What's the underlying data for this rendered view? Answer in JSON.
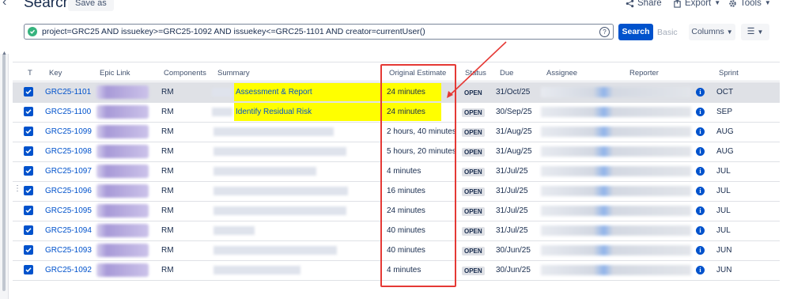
{
  "header": {
    "title": "Search",
    "save_as": "Save as",
    "share": "Share",
    "export": "Export",
    "tools": "Tools"
  },
  "search": {
    "jql": "project=GRC25 AND issuekey>=GRC25-1092 AND issuekey<=GRC25-1101 AND creator=currentUser()",
    "search_button": "Search",
    "basic_link": "Basic",
    "columns_button": "Columns"
  },
  "columns": [
    "T",
    "Key",
    "Epic Link",
    "Components",
    "Summary",
    "Original Estimate",
    "Status",
    "Due",
    "Assignee",
    "Reporter",
    "Sprint"
  ],
  "rows": [
    {
      "key": "GRC25-1101",
      "component": "RM",
      "summary": "Assessment & Report",
      "estimate": "24 minutes",
      "status": "OPEN",
      "due": "31/Oct/25",
      "sprint": "OCT"
    },
    {
      "key": "GRC25-1100",
      "component": "RM",
      "summary": "Identify Residual Risk",
      "estimate": "24 minutes",
      "status": "OPEN",
      "due": "30/Sep/25",
      "sprint": "SEP"
    },
    {
      "key": "GRC25-1099",
      "component": "RM",
      "summary": "",
      "estimate": "2 hours, 40 minutes",
      "status": "OPEN",
      "due": "31/Aug/25",
      "sprint": "AUG"
    },
    {
      "key": "GRC25-1098",
      "component": "RM",
      "summary": "",
      "estimate": "5 hours, 20 minutes",
      "status": "OPEN",
      "due": "31/Aug/25",
      "sprint": "AUG"
    },
    {
      "key": "GRC25-1097",
      "component": "RM",
      "summary": "",
      "estimate": "4 minutes",
      "status": "OPEN",
      "due": "31/Jul/25",
      "sprint": "JUL"
    },
    {
      "key": "GRC25-1096",
      "component": "RM",
      "summary": "",
      "estimate": "16 minutes",
      "status": "OPEN",
      "due": "31/Jul/25",
      "sprint": "JUL"
    },
    {
      "key": "GRC25-1095",
      "component": "RM",
      "summary": "",
      "estimate": "24 minutes",
      "status": "OPEN",
      "due": "31/Jul/25",
      "sprint": "JUL"
    },
    {
      "key": "GRC25-1094",
      "component": "RM",
      "summary": "",
      "estimate": "40 minutes",
      "status": "OPEN",
      "due": "31/Jul/25",
      "sprint": "JUL"
    },
    {
      "key": "GRC25-1093",
      "component": "RM",
      "summary": "",
      "estimate": "40 minutes",
      "status": "OPEN",
      "due": "30/Jun/25",
      "sprint": "JUN"
    },
    {
      "key": "GRC25-1092",
      "component": "RM",
      "summary": "",
      "estimate": "4 minutes",
      "status": "OPEN",
      "due": "30/Jun/25",
      "sprint": "JUN"
    }
  ],
  "colors": {
    "accent": "#0052cc",
    "highlight": "#ffff00",
    "annotation": "#e53935"
  }
}
